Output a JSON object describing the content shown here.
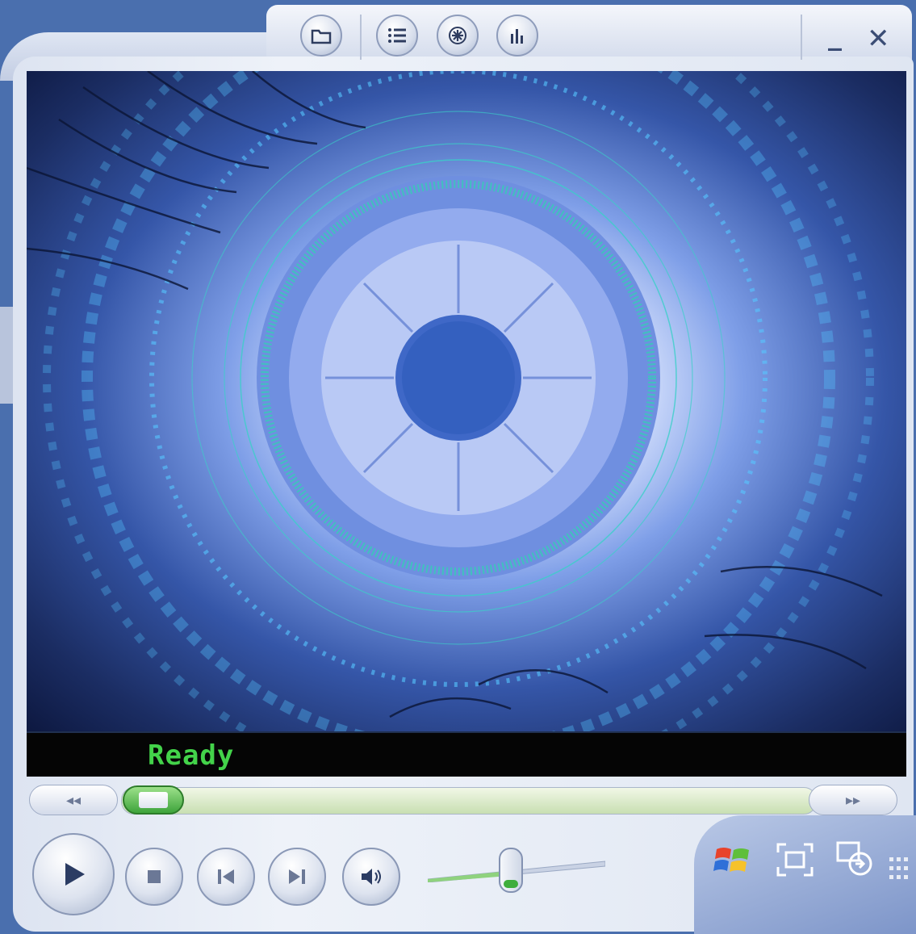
{
  "window": {
    "title_buttons": [
      {
        "name": "folder-icon"
      },
      {
        "name": "playlist-icon"
      },
      {
        "name": "visualization-icon"
      },
      {
        "name": "equalizer-icon"
      }
    ],
    "minimize_glyph": "_",
    "close_glyph": "✕"
  },
  "status": {
    "text": "Ready",
    "color": "#43d34a"
  },
  "seek": {
    "rewind_glyph": "◂◂",
    "forward_glyph": "▸▸",
    "position": 0.02
  },
  "controls": [
    {
      "name": "play-icon"
    },
    {
      "name": "stop-icon"
    },
    {
      "name": "previous-icon"
    },
    {
      "name": "next-icon"
    },
    {
      "name": "mute-icon"
    }
  ],
  "volume": {
    "level": 0.45
  },
  "bottom_right_icons": [
    "windows-logo-icon",
    "fullscreen-icon",
    "skin-mode-icon"
  ],
  "colors": {
    "accent_green": "#3ea43b",
    "frame": "#dde4f1",
    "video_blue": "#3556a8"
  }
}
